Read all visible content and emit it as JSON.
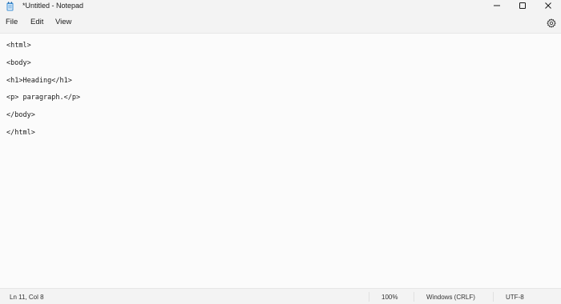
{
  "window": {
    "title": "*Untitled - Notepad",
    "icon": "notepad-icon",
    "controls": [
      "minimize-icon",
      "maximize-icon",
      "close-icon"
    ]
  },
  "menu": {
    "file": "File",
    "edit": "Edit",
    "view": "View",
    "settings_icon": "gear-icon"
  },
  "editor": {
    "lines": [
      "<html>",
      "",
      "<body>",
      "",
      "<h1>Heading</h1>",
      "",
      "<p> paragraph.</p>",
      "",
      "</body>",
      "",
      "</html>"
    ]
  },
  "status": {
    "position": "Ln 11, Col 8",
    "zoom": "100%",
    "line_ending": "Windows (CRLF)",
    "encoding": "UTF-8"
  },
  "colors": {
    "chrome": "#f3f3f3",
    "editor_bg": "#fbfbfb",
    "icon_blue": "#3b8fd6"
  }
}
